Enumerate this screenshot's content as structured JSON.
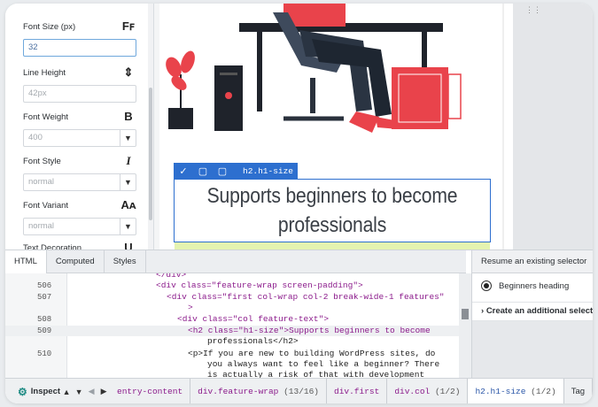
{
  "style_panel": {
    "properties": [
      {
        "label": "Font Size (px)",
        "icon": "font-size-icon",
        "icon_glyph": "Fꜰ",
        "value": "32",
        "kind": "input",
        "active": true
      },
      {
        "label": "Line Height",
        "icon": "line-height-icon",
        "icon_glyph": "⇕",
        "value": "42px",
        "kind": "input",
        "active": false
      },
      {
        "label": "Font Weight",
        "icon": "font-weight-icon",
        "icon_glyph": "B",
        "value": "400",
        "kind": "select"
      },
      {
        "label": "Font Style",
        "icon": "font-style-icon",
        "icon_glyph": "I",
        "value": "normal",
        "kind": "select"
      },
      {
        "label": "Font Variant",
        "icon": "font-variant-icon",
        "icon_glyph": "Aᴀ",
        "value": "normal",
        "kind": "select"
      },
      {
        "label": "Text Decoration",
        "icon": "text-decoration-icon",
        "icon_glyph": "U",
        "value": "",
        "kind": "select"
      }
    ]
  },
  "preview": {
    "selection_label": "h2.h1-size",
    "heading": "Supports beginners to become professionals"
  },
  "devtools": {
    "tabs": [
      "HTML",
      "Computed",
      "Styles"
    ],
    "code_lines": [
      {
        "num": "",
        "text": "</div>"
      },
      {
        "num": "506",
        "text": "<div class=\"feature-wrap screen-padding\">"
      },
      {
        "num": "507",
        "text": "<div class=\"first col-wrap col-2 break-wide-1 features\""
      },
      {
        "num": "",
        "text": ">"
      },
      {
        "num": "508",
        "text": "<div class=\"col feature-text\">"
      },
      {
        "num": "509",
        "text": "<h2 class=\"h1-size\">Supports beginners to become"
      },
      {
        "num": "",
        "text": "professionals</h2>"
      },
      {
        "num": "510",
        "text": "<p>If you are new to building WordPress sites, do"
      },
      {
        "num": "",
        "text": "you always want to feel like a beginner? There"
      },
      {
        "num": "",
        "text": "is actually a risk of that with development"
      }
    ],
    "side_panel": {
      "heading": "Resume an existing selector",
      "radio_label": "Beginners heading",
      "create_label": "Create an additional selector"
    },
    "bottom_bar": {
      "inspect_label": "Inspect",
      "breadcrumbs": [
        {
          "label": "entry-content",
          "count": ""
        },
        {
          "label": "div.feature-wrap",
          "count": "(13/16)"
        },
        {
          "label": "div.first",
          "count": ""
        },
        {
          "label": "div.col",
          "count": "(1/2)"
        },
        {
          "label": "h2.h1-size",
          "count": "(1/2)"
        },
        {
          "label": "Tag",
          "count": ""
        }
      ]
    }
  },
  "colors": {
    "accent": "#2d6fcf",
    "highlight": "#e4f3b0",
    "inspect_gear": "#1d8a83"
  }
}
